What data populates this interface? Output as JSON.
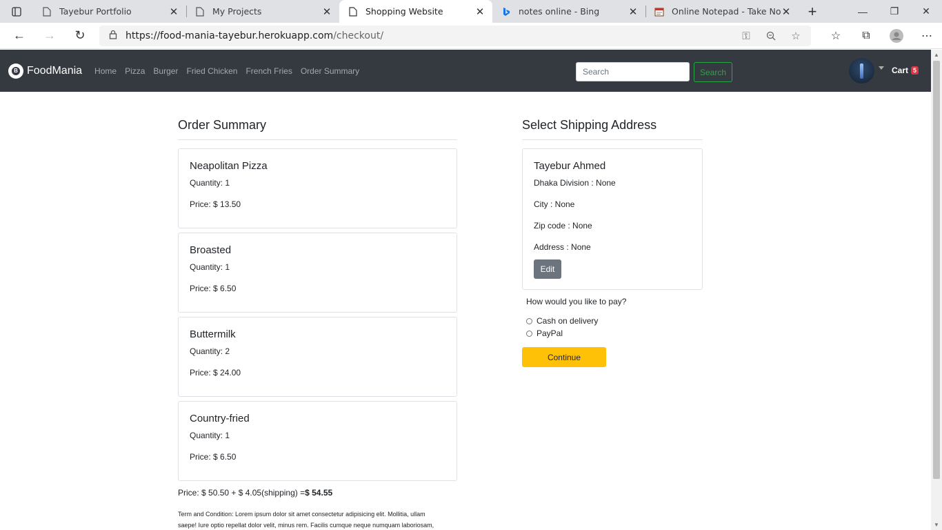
{
  "browser": {
    "tabs": [
      {
        "title": "Tayebur Portfolio",
        "icon": "page-icon"
      },
      {
        "title": "My Projects",
        "icon": "page-icon"
      },
      {
        "title": "Shopping Website",
        "icon": "page-icon"
      },
      {
        "title": "notes online - Bing",
        "icon": "bing-icon"
      },
      {
        "title": "Online Notepad - Take Notes",
        "icon": "notepad-icon"
      }
    ],
    "url_host": "https://food-mania-tayebur.herokuapp.com",
    "url_path": "/checkout/"
  },
  "navbar": {
    "brand": "FoodMania",
    "links": [
      "Home",
      "Pizza",
      "Burger",
      "Fried Chicken",
      "French Fries",
      "Order Summary"
    ],
    "search_placeholder": "Search",
    "search_button": "Search",
    "cart_label": "Cart",
    "cart_count": "5"
  },
  "order": {
    "heading": "Order Summary",
    "items": [
      {
        "name": "Neapolitan Pizza",
        "quantity": "Quantity: 1",
        "price": "Price: $ 13.50"
      },
      {
        "name": "Broasted",
        "quantity": "Quantity: 1",
        "price": "Price: $ 6.50"
      },
      {
        "name": "Buttermilk",
        "quantity": "Quantity: 2",
        "price": "Price: $ 24.00"
      },
      {
        "name": "Country-fried",
        "quantity": "Quantity: 1",
        "price": "Price: $ 6.50"
      }
    ],
    "total_prefix": "Price: $ 50.50 + $ 4.05(shipping) =",
    "total_value": "$ 54.55",
    "terms_line1": "Term and Condition: Lorem ipsum dolor sit amet consectetur adipisicing elit. Mollitia, ullam",
    "terms_line2": "saepe! Iure optio repellat dolor velit, minus rem. Facilis cumque neque numquam laboriosam,"
  },
  "shipping": {
    "heading": "Select Shipping Address",
    "name": "Tayebur Ahmed",
    "division": "Dhaka Division : None",
    "city": "City : None",
    "zip": "Zip code : None",
    "address": "Address : None",
    "edit_label": "Edit",
    "pay_question": "How would you like to pay?",
    "pay_options": [
      "Cash on delivery",
      "PayPal"
    ],
    "continue_label": "Continue"
  },
  "colors": {
    "navbar_bg": "#343a40",
    "search_green": "#28a745",
    "continue_yellow": "#ffc107",
    "badge_red": "#dc3545",
    "edit_gray": "#6c757d"
  }
}
